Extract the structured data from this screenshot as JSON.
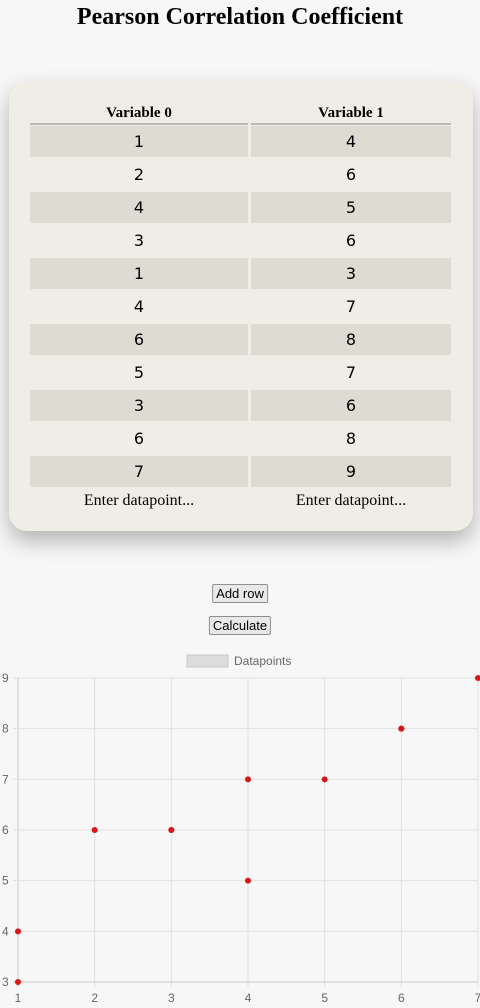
{
  "title": "Pearson Correlation Coefficient",
  "table": {
    "headers": [
      "Variable 0",
      "Variable 1"
    ],
    "rows": [
      [
        "1",
        "4"
      ],
      [
        "2",
        "6"
      ],
      [
        "4",
        "5"
      ],
      [
        "3",
        "6"
      ],
      [
        "1",
        "3"
      ],
      [
        "4",
        "7"
      ],
      [
        "6",
        "8"
      ],
      [
        "5",
        "7"
      ],
      [
        "3",
        "6"
      ],
      [
        "6",
        "8"
      ],
      [
        "7",
        "9"
      ]
    ],
    "input_placeholders": [
      "Enter datapoint...",
      "Enter datapoint..."
    ]
  },
  "buttons": {
    "add_row": "Add row",
    "calculate": "Calculate"
  },
  "colors": {
    "card_bg": "#f0ede6",
    "row_shade": "#dedbd3",
    "point": "#d81818"
  },
  "chart_data": {
    "type": "scatter",
    "series": [
      {
        "name": "Datapoints",
        "points": [
          [
            1,
            4
          ],
          [
            2,
            6
          ],
          [
            4,
            5
          ],
          [
            3,
            6
          ],
          [
            1,
            3
          ],
          [
            4,
            7
          ],
          [
            6,
            8
          ],
          [
            5,
            7
          ],
          [
            3,
            6
          ],
          [
            6,
            8
          ],
          [
            7,
            9
          ]
        ]
      }
    ],
    "x_ticks": [
      "1",
      "2",
      "3",
      "4",
      "5",
      "6",
      "7"
    ],
    "y_ticks": [
      "9",
      "8",
      "7",
      "6",
      "5",
      "4",
      "3"
    ],
    "xlim": [
      1,
      7
    ],
    "ylim": [
      3,
      9
    ],
    "grid": true,
    "legend": "top-center"
  }
}
